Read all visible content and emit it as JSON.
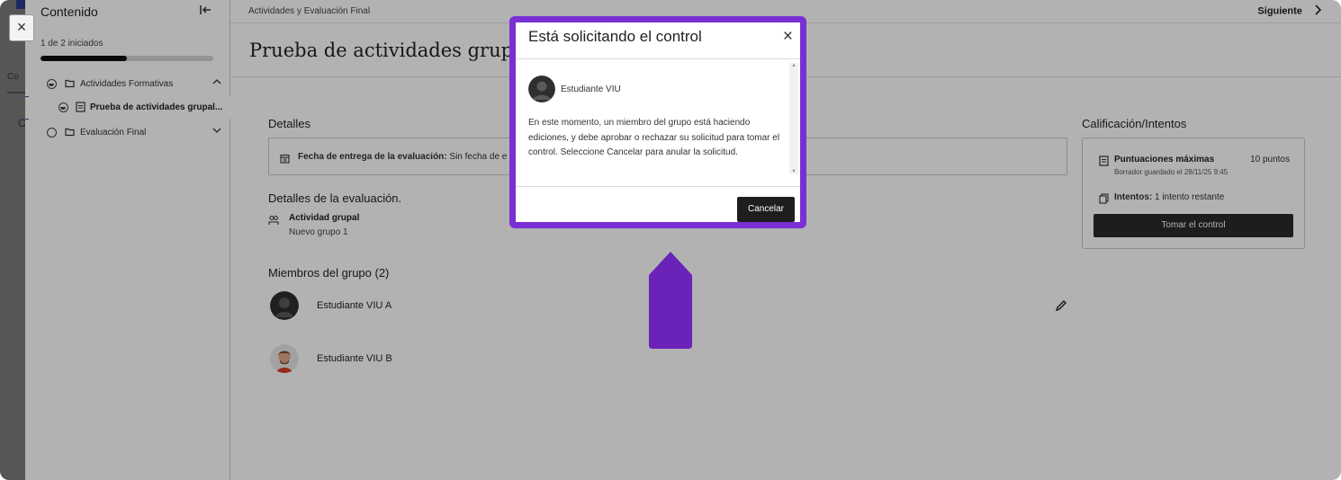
{
  "sidebar": {
    "title": "Contenido",
    "progress_text": "1 de 2 iniciados",
    "progress_fraction": 0.5,
    "items": [
      {
        "label": "Actividades Formativas",
        "kind": "folder",
        "status": "in-progress",
        "chevron": "chevron-up-icon"
      },
      {
        "label": "Prueba de actividades grupal...",
        "kind": "document",
        "status": "in-progress",
        "active": true
      },
      {
        "label": "Evaluación Final",
        "kind": "folder",
        "status": "not-started",
        "chevron": "chevron-down-icon"
      }
    ]
  },
  "app_strip": {
    "tab_fragment": "Co",
    "c_fragment": "C"
  },
  "close_label": "×",
  "topbar": {
    "breadcrumb": "Actividades y Evaluación Final",
    "next_label": "Siguiente"
  },
  "page_title": "Prueba de actividades grupa",
  "details": {
    "heading": "Detalles",
    "due_label": "Fecha de entrega de la evaluación:",
    "due_value": "Sin fecha de e"
  },
  "evaluation": {
    "heading": "Detalles de la evaluación.",
    "type": "Actividad grupal",
    "group": "Nuevo grupo 1"
  },
  "members": {
    "heading": "Miembros del grupo (2)",
    "list": [
      {
        "name": "Estudiante VIU A"
      },
      {
        "name": "Estudiante VIU B"
      }
    ]
  },
  "grading": {
    "heading": "Calificación/Intentos",
    "max_label": "Puntuaciones máximas",
    "max_value": "10 puntos",
    "draft_text": "Borrador guardado el 28/11/25 9:45",
    "attempts_label": "Intentos:",
    "attempts_value": "1 intento restante",
    "take_button": "Tomar el control"
  },
  "modal": {
    "title": "Está solicitando el control",
    "close": "×",
    "user": "Estudiante VIU",
    "message": "En este momento, un miembro del grupo está haciendo ediciones, y debe aprobar o rechazar su solicitud para tomar el control. Seleccione Cancelar para anular la solicitud.",
    "cancel": "Cancelar"
  },
  "colors": {
    "highlight": "#7a2fd4",
    "pointer": "#6a22b8",
    "primary_button": "#1e1e1e"
  }
}
